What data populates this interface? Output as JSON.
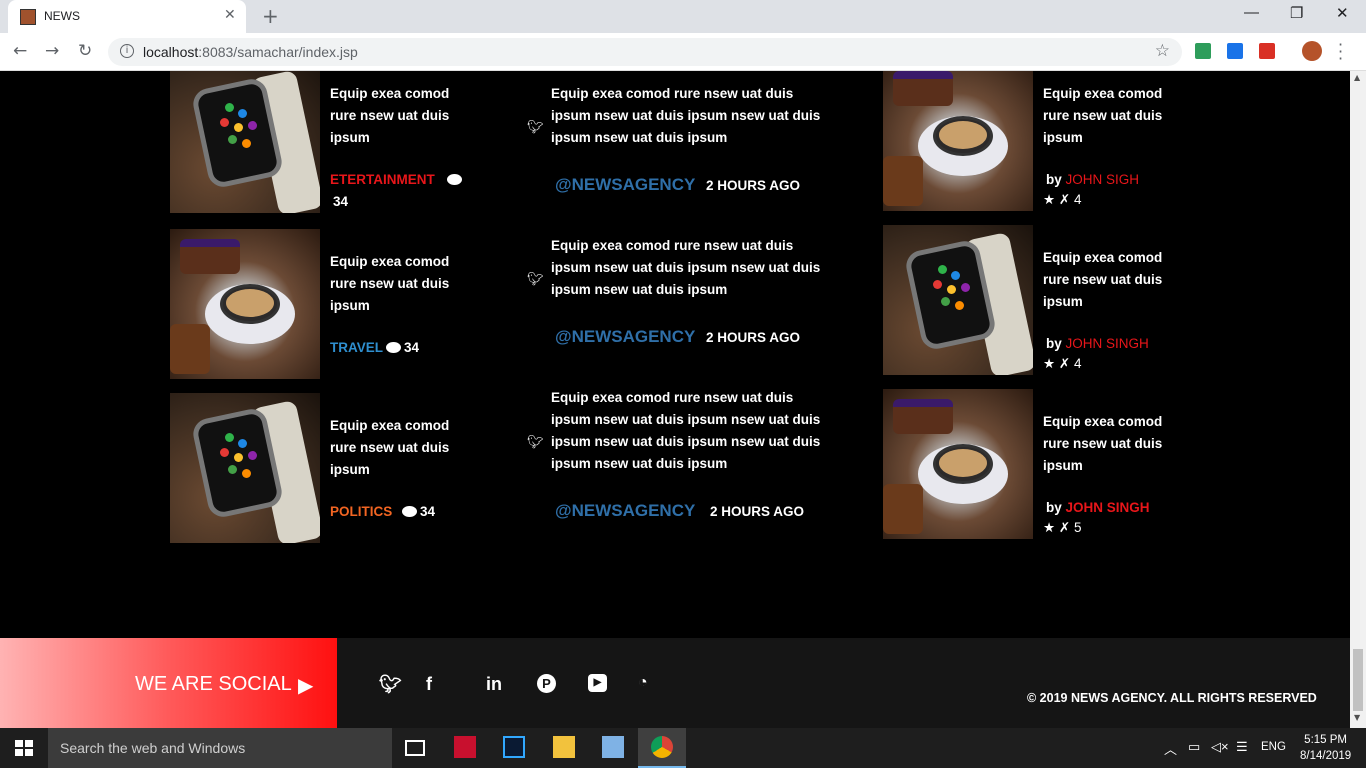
{
  "browser": {
    "tab_title": "NEWS",
    "url_host": "localhost",
    "url_rest": ":8083/samachar/index.jsp"
  },
  "left_column": [
    {
      "text": "Equip exea comod rure  nsew uat duis ipsum",
      "category": "ETERTAINMENT",
      "category_color": "#e8161a",
      "comments": "34",
      "image": "watch"
    },
    {
      "text": "Equip exea comod rure  nsew uat duis ipsum",
      "category": "TRAVEL",
      "category_color": "#2f8fcf",
      "comments": "34",
      "image": "coffee"
    },
    {
      "text": "Equip exea comod rure  nsew uat duis ipsum",
      "category": "POLITICS",
      "category_color": "#f26522",
      "comments": "34",
      "image": "watch"
    }
  ],
  "tweets": [
    {
      "text": "Equip exea comod rure  nsew uat duis ipsum nsew uat duis ipsum nsew uat duis ipsum nsew uat duis ipsum",
      "handle": "@NEWSAGENCY",
      "time": "2 HOURS AGO"
    },
    {
      "text": "Equip exea comod rure  nsew uat duis ipsum nsew uat duis ipsum nsew uat duis ipsum nsew uat duis ipsum",
      "handle": "@NEWSAGENCY",
      "time": "2 HOURS AGO"
    },
    {
      "text": "Equip exea comod rure nsew uat duis ipsum nsew uat duis ipsum nsew uat duis ipsum nsew uat duis ipsum nsew uat duis ipsum nsew uat duis ipsum",
      "handle": "@NEWSAGENCY",
      "time": "2 HOURS AGO"
    }
  ],
  "right_column": [
    {
      "text": "Equip exea comod rure  nsew uat duis ipsum",
      "by": "by",
      "author": "JOHN SIGH",
      "rating": "4",
      "image": "coffee"
    },
    {
      "text": "Equip exea comod rure  nsew uat duis ipsum",
      "by": "by",
      "author": "JOHN SINGH",
      "rating": "4",
      "image": "watch"
    },
    {
      "text": "Equip exea comod rure  nsew uat duis ipsum",
      "by": "by",
      "author": "JOHN SINGH",
      "rating": "5",
      "image": "coffee"
    }
  ],
  "footer": {
    "social_label": "WE ARE SOCIAL",
    "social_icons": [
      "twitter-icon",
      "facebook-icon",
      "linkedin-icon",
      "pinterest-icon",
      "youtube-icon",
      "rss-icon"
    ],
    "copyright": "© 2019  NEWS AGENCY.  ALL RIGHTS RESERVED"
  },
  "taskbar": {
    "search_placeholder": "Search the web and Windows",
    "language": "ENG",
    "time": "5:15 PM",
    "date": "8/14/2019"
  }
}
